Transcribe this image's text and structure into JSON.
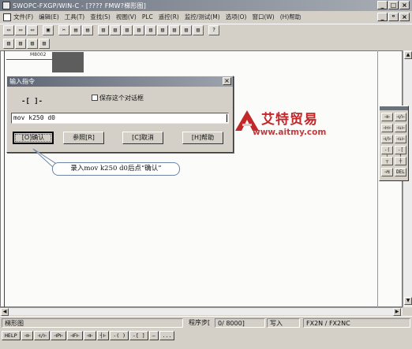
{
  "window": {
    "title": "SWOPC-FXGP/WIN-C - [???? FMW?梯形图]"
  },
  "menu": [
    "文件(F)",
    "编辑(E)",
    "工具(T)",
    "查找(S)",
    "视图(V)",
    "PLC",
    "遥控(R)",
    "监控/测试(M)",
    "选项(O)",
    "窗口(W)",
    "(H)帮助"
  ],
  "toolbar1": [
    "▭",
    "▭",
    "▭",
    "▣",
    "✂",
    "▤",
    "▤",
    "▥",
    "▥",
    "▥",
    "▥",
    "▥",
    "▥",
    "▥",
    "▥",
    "▥",
    "?"
  ],
  "toolbar2": [
    "▥",
    "▥",
    "▥",
    "▥"
  ],
  "ladder": {
    "contact_label": "M8002"
  },
  "dialog": {
    "title": "输入指令",
    "symbol": "-[ ]-",
    "checkbox_label": "保存这个对话框",
    "input_value": "mov k250 d0",
    "buttons": {
      "ok": "[O]确认",
      "reference": "参照[R]",
      "cancel": "[C]取消",
      "help": "[H]帮助"
    }
  },
  "callout": {
    "text": "录入mov k250 d0后点“确认”"
  },
  "watermark": {
    "brand": "艾特贸易",
    "url": "www.aitmy.com"
  },
  "palette": [
    "⊣⊢",
    "⊣/⊢",
    "⊣↑⊢",
    "⊣↓⊢",
    "⊣/⊢",
    "⊣↓⊢",
    "-( )",
    "-[ ]",
    "┬",
    "┼",
    "⊣↯",
    "DEL"
  ],
  "statusbar": {
    "mode": "梯形图",
    "program_step_label": "程序步[",
    "program_step_value": "0/ 8000]",
    "write_mode": "写入",
    "plc_model": "FX2N / FX2NC"
  },
  "function_keys": [
    "HELP",
    "⊣⊢",
    "⊣/⊢",
    "⊣P⊢",
    "⊣F⊢",
    "⊣⊢",
    "┤⊢",
    "-( )",
    "-[ ]",
    "—",
    "..."
  ]
}
